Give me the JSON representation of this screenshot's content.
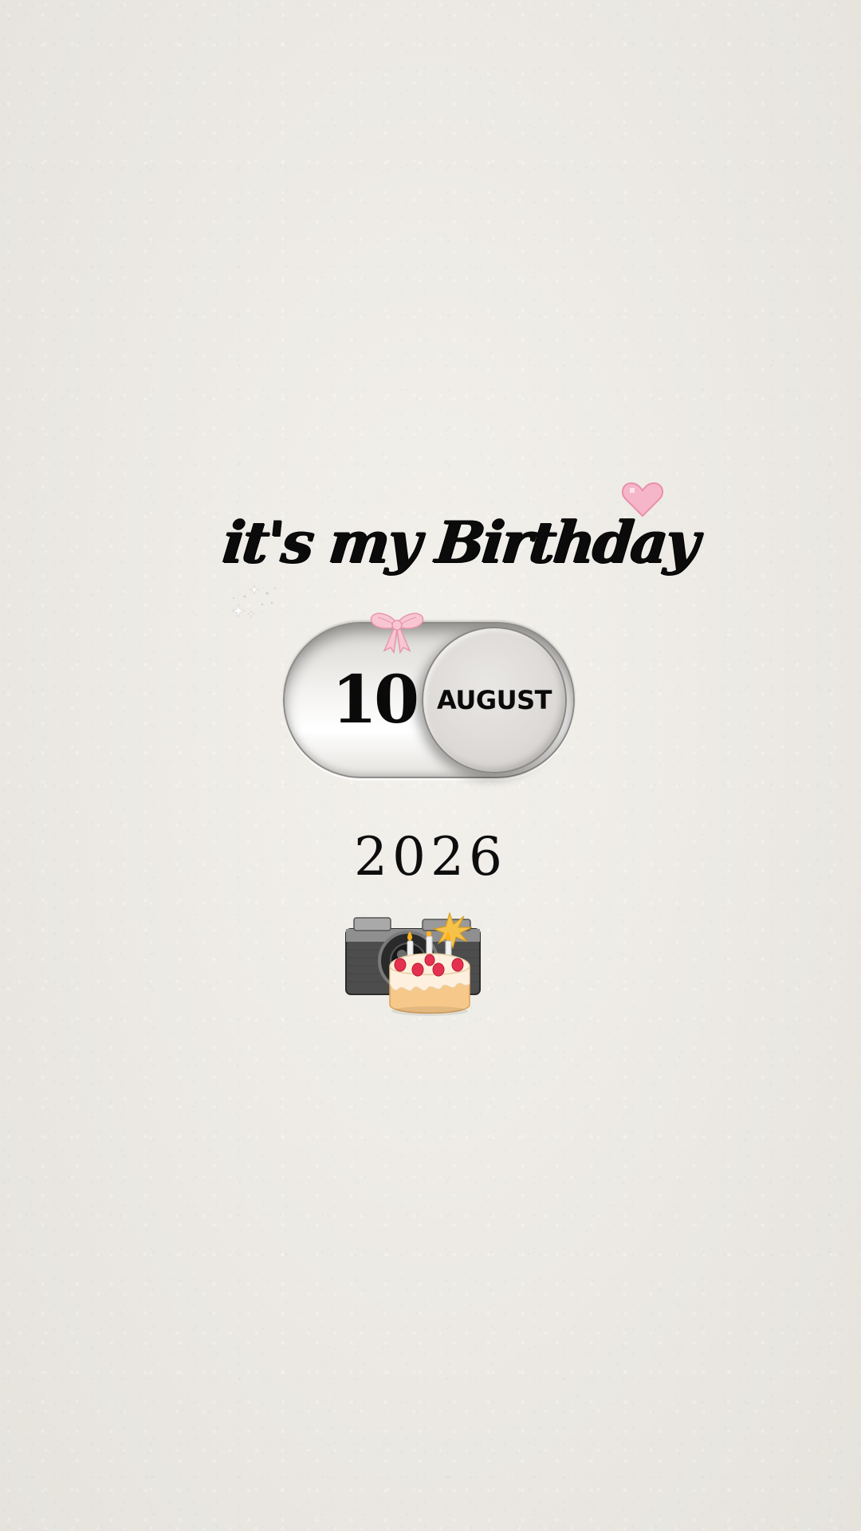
{
  "greeting": {
    "title": "it's my Birthday"
  },
  "date_toggle": {
    "day": "10",
    "month": "AUGUST"
  },
  "year": "2026",
  "decorations": {
    "icons": [
      "heart-icon",
      "sparkle-icon",
      "bow-icon",
      "camera-icon",
      "birthday-cake-icon"
    ],
    "colors": {
      "background": "#efece6",
      "text": "#0b0b0b",
      "heart": "#f6b6c9",
      "bow": "#f4b8c8"
    }
  }
}
